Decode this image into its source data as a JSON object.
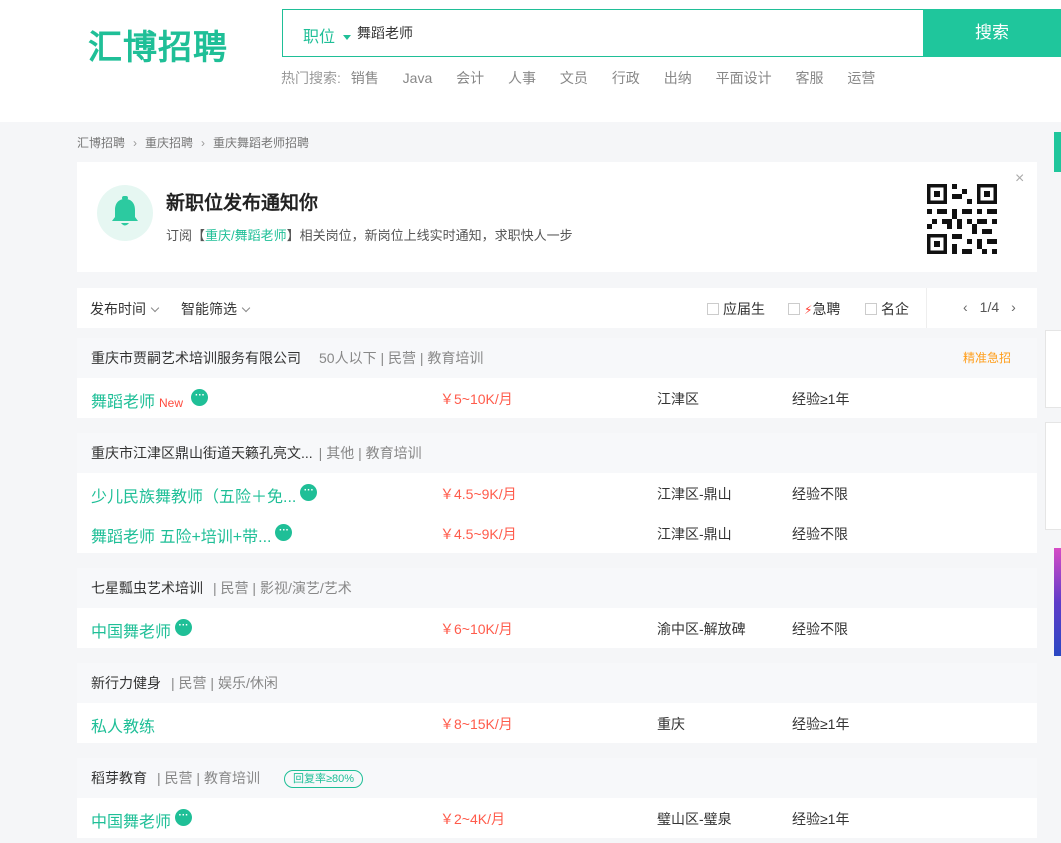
{
  "header": {
    "logo": "汇博招聘",
    "search_type": "职位",
    "search_value": "舞蹈老师",
    "search_button": "搜索",
    "hot_label": "热门搜索:",
    "hot_terms": [
      "销售",
      "Java",
      "会计",
      "人事",
      "文员",
      "行政",
      "出纳",
      "平面设计",
      "客服",
      "运营"
    ]
  },
  "breadcrumb": [
    "汇博招聘",
    "重庆招聘",
    "重庆舞蹈老师招聘"
  ],
  "notify": {
    "title": "新职位发布通知你",
    "sub_prefix": "订阅【",
    "sub_highlight": "重庆/舞蹈老师",
    "sub_suffix": "】相关岗位，新岗位上线实时通知，求职快人一步",
    "close": "×"
  },
  "filters": {
    "publish_time": "发布时间",
    "smart_filter": "智能筛选",
    "fresh_grad": "应届生",
    "urgent": "急聘",
    "famous": "名企",
    "page": "1/4"
  },
  "companies": [
    {
      "name": "重庆市贾嗣艺术培训服务有限公司",
      "meta": "50人以下 | 民营 | 教育培训",
      "badge": "精准急招",
      "jobs": [
        {
          "title": "舞蹈老师",
          "new": "New",
          "salary": "￥5~10K/月",
          "location": "江津区",
          "experience": "经验≥1年"
        }
      ]
    },
    {
      "name": "重庆市江津区鼎山街道天籁孔亮文...",
      "meta": "| 其他 | 教育培训",
      "jobs": [
        {
          "title": "少儿民族舞教师（五险＋免...",
          "salary": "￥4.5~9K/月",
          "location": "江津区-鼎山",
          "experience": "经验不限"
        },
        {
          "title": "舞蹈老师 五险+培训+带...",
          "salary": "￥4.5~9K/月",
          "location": "江津区-鼎山",
          "experience": "经验不限"
        }
      ]
    },
    {
      "name": "七星瓢虫艺术培训",
      "meta": "| 民营 | 影视/演艺/艺术",
      "jobs": [
        {
          "title": "中国舞老师",
          "salary": "￥6~10K/月",
          "location": "渝中区-解放碑",
          "experience": "经验不限"
        }
      ]
    },
    {
      "name": "新行力健身",
      "meta": "| 民营 | 娱乐/休闲",
      "jobs": [
        {
          "title": "私人教练",
          "salary": "￥8~15K/月",
          "location": "重庆",
          "experience": "经验≥1年"
        }
      ]
    },
    {
      "name": "稻芽教育",
      "meta": "| 民营 | 教育培训",
      "reply_badge": "回复率≥80%",
      "jobs": [
        {
          "title": "中国舞老师",
          "salary": "￥2~4K/月",
          "location": "璧山区-璧泉",
          "experience": "经验≥1年"
        }
      ]
    }
  ],
  "colors": {
    "brand": "#1fbf97",
    "salary": "#ff5b4b",
    "urgent_badge": "#ff9e1b"
  }
}
